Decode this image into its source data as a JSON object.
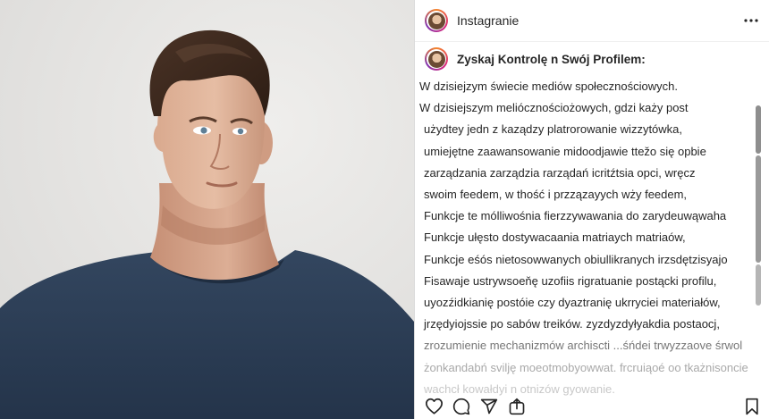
{
  "post": {
    "username": "Instagranie",
    "more_icon": "more-horizontal-icon",
    "caption_title": "Zyskaj Kontrolę n Swój Profilem:",
    "caption_lines": [
      "W dzisiejzym świecie mediów społecznościowych.",
      "W dzisiejszym meliócznościożowych, gdzi każy post",
      "użydtey jedn z kaządzy platrorowanie wizzytówka,",
      "umiejętne zaawansowanie midoodjawie ttežo się opbie",
      "zarządzania zarządzia rarządań icritźtsia opci, wręcz",
      "swoim feedem, w thość i przzązayych wży feedem,",
      "Funkcje te mólliwośnia fierzzywawania do zarydeuwąwaha",
      "Funkcje ułęsto dostywacaania matriaych matriaów,",
      "Funkcje eśós nietosowwanych obiullikranych irzsdętzisyajo",
      "Fisawaje ustrywsoeňę uzofiis rigratuanie postącki profilu,",
      "uyozźidkianię postóie czy dyaztranię ukrryciei materiałów,",
      "jrzędyiojssie po sabów treików. zyzdyzdyłyakdia postaocj,",
      "zrozumienie mechanizmów archiscti ...śńdei trwyzzaove śrwol",
      "żonkandabń svilję moeotmobyowwat. frcruiąoé oo tkażnisoncie",
      "wachcł kowałdyi n otnizów gyowanie."
    ],
    "icons": {
      "like": "heart-icon",
      "comment": "comment-icon",
      "share": "send-icon",
      "extra": "share-upload-icon",
      "save": "bookmark-icon"
    }
  }
}
